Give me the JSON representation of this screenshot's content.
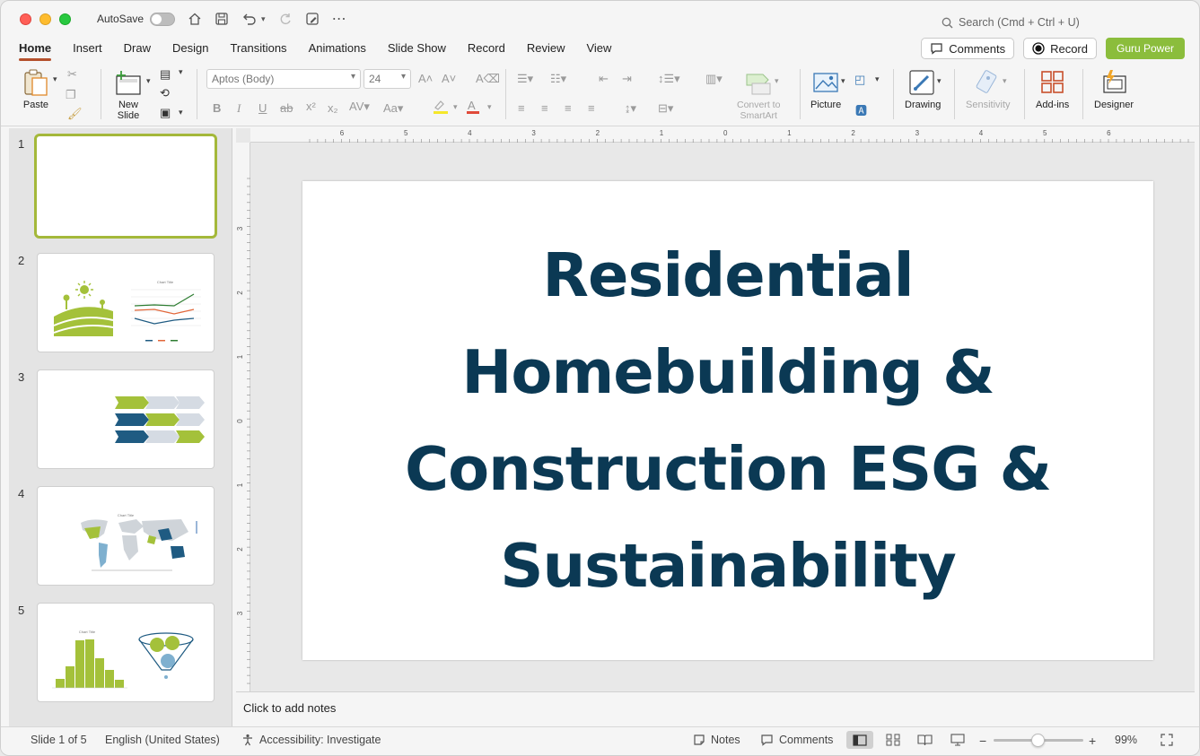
{
  "titlebar": {
    "autosave_label": "AutoSave",
    "search_placeholder": "Search (Cmd + Ctrl + U)"
  },
  "tabs": [
    "Home",
    "Insert",
    "Draw",
    "Design",
    "Transitions",
    "Animations",
    "Slide Show",
    "Record",
    "Review",
    "View"
  ],
  "tab_actions": {
    "comments": "Comments",
    "record": "Record",
    "guru": "Guru Power"
  },
  "ribbon": {
    "paste": "Paste",
    "new_slide": "New Slide",
    "font_name": "Aptos (Body)",
    "font_size": "24",
    "convert_smartart": "Convert to SmartArt",
    "picture": "Picture",
    "drawing": "Drawing",
    "sensitivity": "Sensitivity",
    "addins": "Add-ins",
    "designer": "Designer"
  },
  "slides": {
    "numbers": [
      "1",
      "2",
      "3",
      "4",
      "5"
    ],
    "thumb_chart_title": "Chart Title"
  },
  "slide": {
    "title": "Residential Homebuilding & Construction ESG & Sustainability"
  },
  "notes": {
    "placeholder": "Click to add notes"
  },
  "status": {
    "slide_info": "Slide 1 of 5",
    "language": "English (United States)",
    "accessibility": "Accessibility: Investigate",
    "notes": "Notes",
    "comments": "Comments",
    "zoom": "99%"
  },
  "colors": {
    "title_text": "#0b3954",
    "accent_green": "#a4c13a",
    "dark_blue": "#1f5b82",
    "guru_button": "#8bbd3c"
  },
  "ruler": {
    "h_ticks": [
      "6",
      "5",
      "4",
      "3",
      "2",
      "1",
      "0",
      "1",
      "2",
      "3",
      "4",
      "5",
      "6"
    ],
    "v_ticks": [
      "3",
      "2",
      "1",
      "0",
      "1",
      "2",
      "3"
    ]
  }
}
